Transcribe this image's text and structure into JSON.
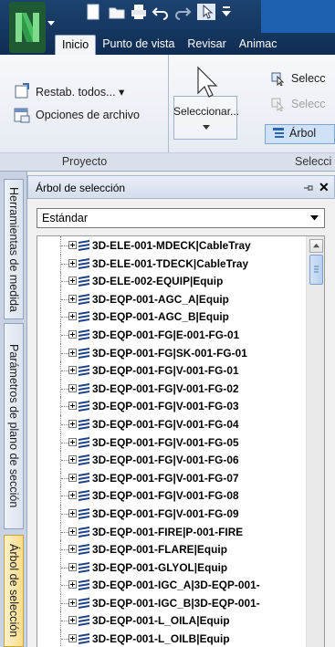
{
  "ribbon": {
    "tabs": [
      "Inicio",
      "Punto de vista",
      "Revisar",
      "Animac"
    ],
    "active_tab": "Inicio",
    "proyecto": {
      "reset_label": "Restab. todos... ▾",
      "file_options_label": "Opciones de archivo",
      "group_label": "Proyecto"
    },
    "seleccion": {
      "select_label": "Seleccionar...",
      "select_same_label": "Selecc",
      "select_all_label": "Selecc",
      "tree_label": "Árbol",
      "group_label": "Selecci"
    }
  },
  "side_tabs": [
    "Herramientas de medida",
    "Parámetros de plano de sección",
    "Árbol de selección"
  ],
  "panel": {
    "title": "Árbol de selección",
    "dropdown_value": "Estándar",
    "items": [
      "3D-ELE-001-MDECK|CableTray",
      "3D-ELE-001-TDECK|CableTray",
      "3D-ELE-002-EQUIP|Equip",
      "3D-EQP-001-AGC_A|Equip",
      "3D-EQP-001-AGC_B|Equip",
      "3D-EQP-001-FG|E-001-FG-01",
      "3D-EQP-001-FG|SK-001-FG-01",
      "3D-EQP-001-FG|V-001-FG-01",
      "3D-EQP-001-FG|V-001-FG-02",
      "3D-EQP-001-FG|V-001-FG-03",
      "3D-EQP-001-FG|V-001-FG-04",
      "3D-EQP-001-FG|V-001-FG-05",
      "3D-EQP-001-FG|V-001-FG-06",
      "3D-EQP-001-FG|V-001-FG-07",
      "3D-EQP-001-FG|V-001-FG-08",
      "3D-EQP-001-FG|V-001-FG-09",
      "3D-EQP-001-FIRE|P-001-FIRE",
      "3D-EQP-001-FLARE|Equip",
      "3D-EQP-001-GLYOL|Equip",
      "3D-EQP-001-IGC_A|3D-EQP-001-",
      "3D-EQP-001-IGC_B|3D-EQP-001-",
      "3D-EQP-001-L_OILA|Equip",
      "3D-EQP-001-L_OILB|Equip"
    ]
  },
  "colors": {
    "title_bar": "#163a66",
    "app_logo_green": "#1f5a34",
    "tree_icon_blue": "#1c3f8a",
    "scroll_thumb": "#b5d0ee",
    "active_side_tab": "#f7dc8a"
  }
}
